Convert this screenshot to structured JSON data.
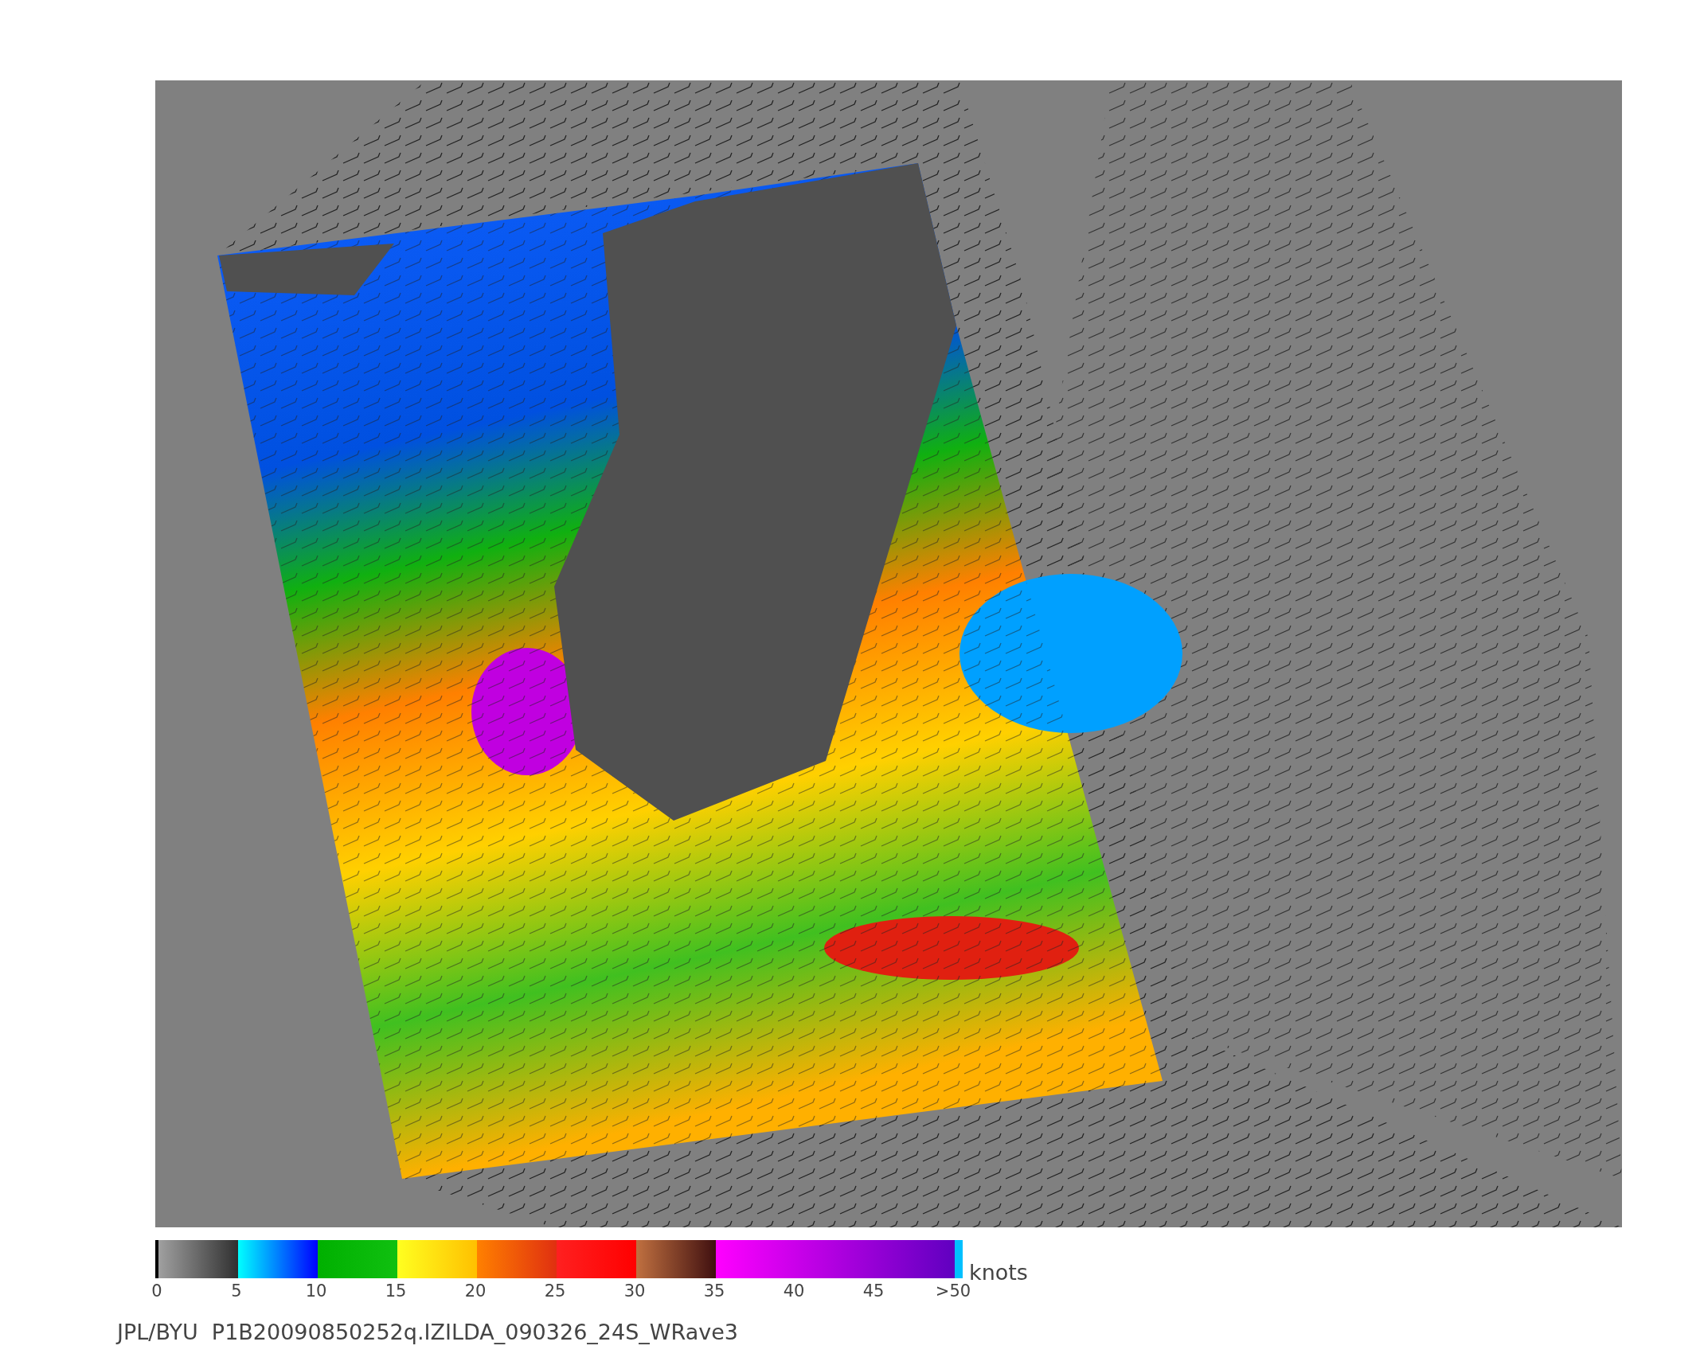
{
  "colorbar": {
    "ticks": [
      "0",
      "5",
      "10",
      "15",
      "20",
      "25",
      "30",
      "35",
      "40",
      "45",
      ">50"
    ],
    "unit": "knots"
  },
  "caption": "JPL/BYU  P1B20090850252q.IZILDA_090326_24S_WRave3"
}
